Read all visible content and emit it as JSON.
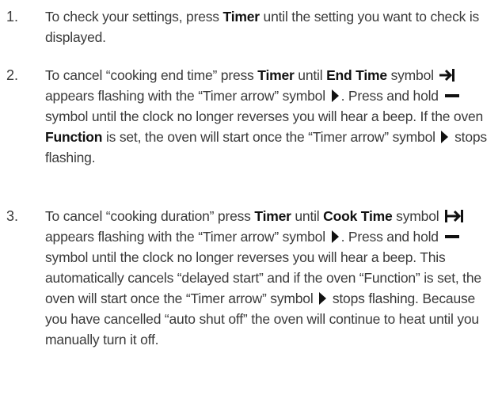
{
  "steps": [
    {
      "number": "1.",
      "t1": "To check your settings, press ",
      "b1": "Timer",
      "t2": " until the setting you want to check is displayed."
    },
    {
      "number": "2.",
      "t1": "To cancel “cooking end time” press ",
      "b1": "Timer",
      "t2": " until ",
      "b2": "End Time",
      "t3": " symbol ",
      "t4": " appears flashing with the “Timer arrow” symbol ",
      "t5": ". Press and hold ",
      "t6": " symbol until the clock no longer reverses you will hear a beep. If the oven ",
      "b3": "Function",
      "t7": " is set, the oven will start once the “Timer arrow” symbol ",
      "t8": " stops flashing."
    },
    {
      "number": "3.",
      "t1": "To cancel “cooking duration” press ",
      "b1": "Timer",
      "t2": " until ",
      "b2": "Cook Time",
      "t3": " symbol ",
      "t4": " appears flashing with the “Timer arrow” symbol ",
      "t5": ". Press and hold ",
      "t6": " symbol until the clock no longer reverses you will hear a beep. This automatically cancels “delayed start” and if the oven “Function” is set, the oven will start once the “Timer arrow” symbol ",
      "t7": " stops flashing. Because you have cancelled “auto shut off” the oven will continue to heat until you manually turn it off."
    }
  ],
  "icons": [
    "end-time-arrow-icon",
    "cook-time-bracket-arrow-icon",
    "timer-arrow-icon",
    "minus-icon"
  ]
}
